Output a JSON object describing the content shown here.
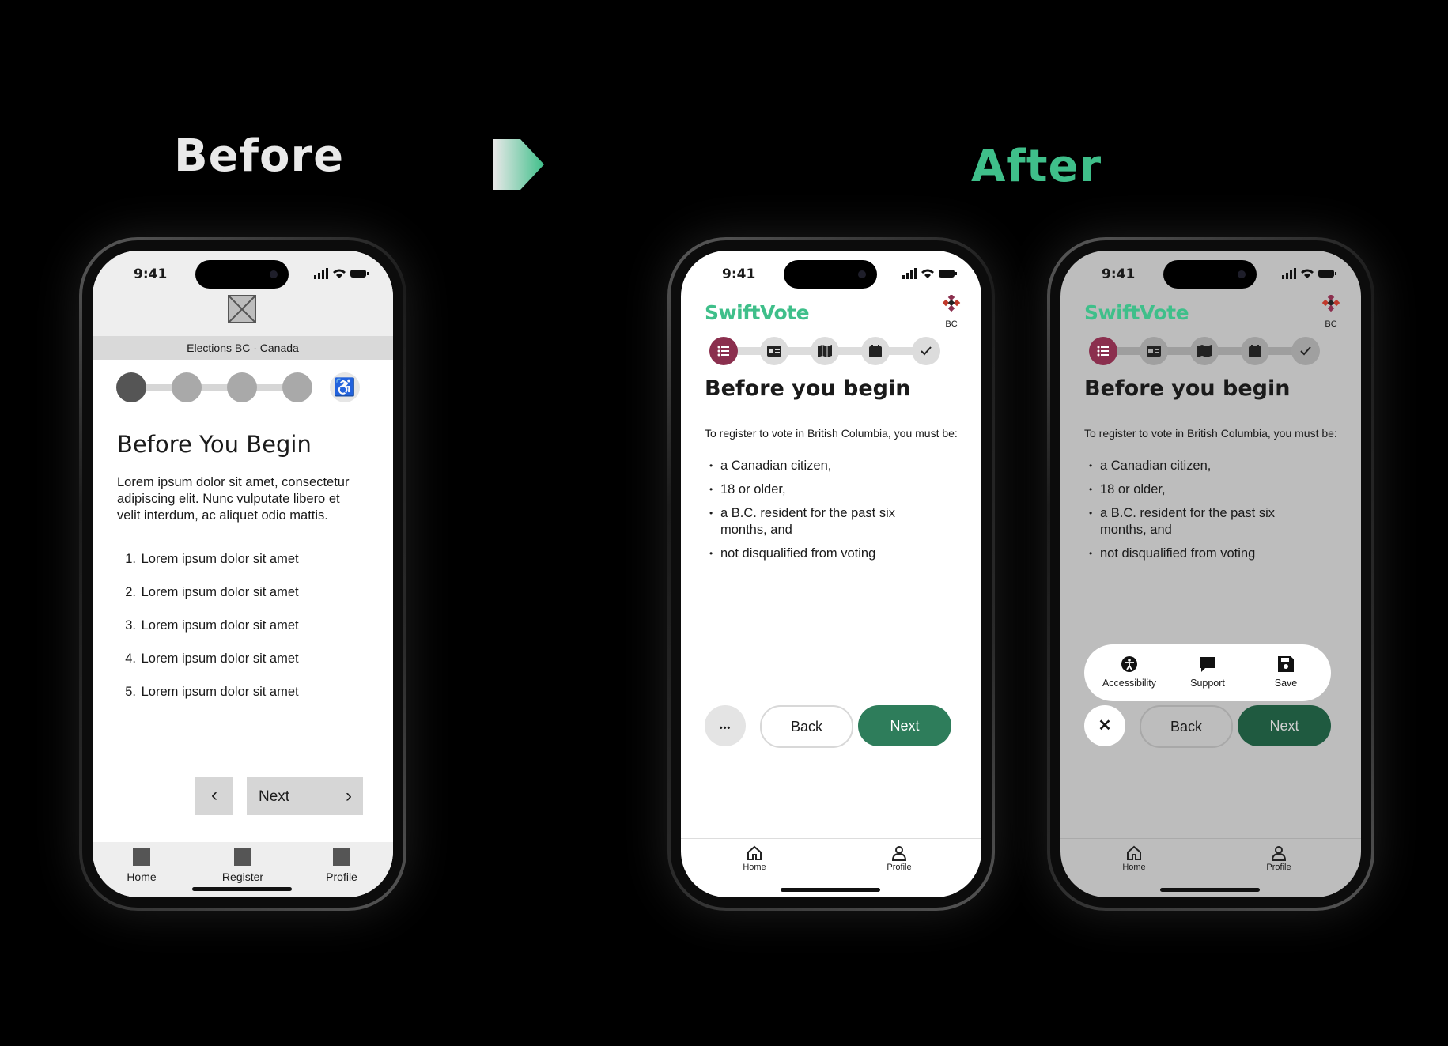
{
  "headings": {
    "before": "Before",
    "after": "After"
  },
  "colors": {
    "accent_green": "#3fbf8a",
    "button_green": "#2e7d5b",
    "step_active": "#8b2f4e"
  },
  "status_bar": {
    "time": "9:41"
  },
  "before_phone": {
    "header_band": "Elections BC · Canada",
    "accessibility_icon": "wheelchair-icon",
    "title": "Before You Begin",
    "paragraph": "Lorem ipsum dolor sit amet, consectetur adipiscing elit. Nunc vulputate libero et velit interdum, ac aliquet odio mattis.",
    "list": [
      {
        "num": "1.",
        "text": "Lorem ipsum dolor sit amet"
      },
      {
        "num": "2.",
        "text": "Lorem ipsum dolor sit amet"
      },
      {
        "num": "3.",
        "text": "Lorem ipsum dolor sit amet"
      },
      {
        "num": "4.",
        "text": "Lorem ipsum dolor sit amet"
      },
      {
        "num": "5.",
        "text": "Lorem ipsum dolor sit amet"
      }
    ],
    "prev_glyph": "‹",
    "next_label": "Next",
    "next_glyph": "›",
    "tabs": [
      "Home",
      "Register",
      "Profile"
    ]
  },
  "after_phone": {
    "brand": "SwiftVote",
    "bc_label": "BC",
    "steps": [
      "list-icon",
      "id-card-icon",
      "map-icon",
      "calendar-icon",
      "check-icon"
    ],
    "title": "Before you begin",
    "intro": "To register to vote in British Columbia, you must be:",
    "requirements": [
      "a Canadian citizen,",
      "18 or older,",
      "a B.C. resident for the past six months, and",
      "not disqualified from voting"
    ],
    "more_glyph": "•••",
    "back_label": "Back",
    "next_label": "Next",
    "tabs": [
      "Home",
      "Profile"
    ]
  },
  "after_menu_phone": {
    "close_glyph": "✕",
    "menu": [
      "Accessibility",
      "Support",
      "Save"
    ]
  }
}
